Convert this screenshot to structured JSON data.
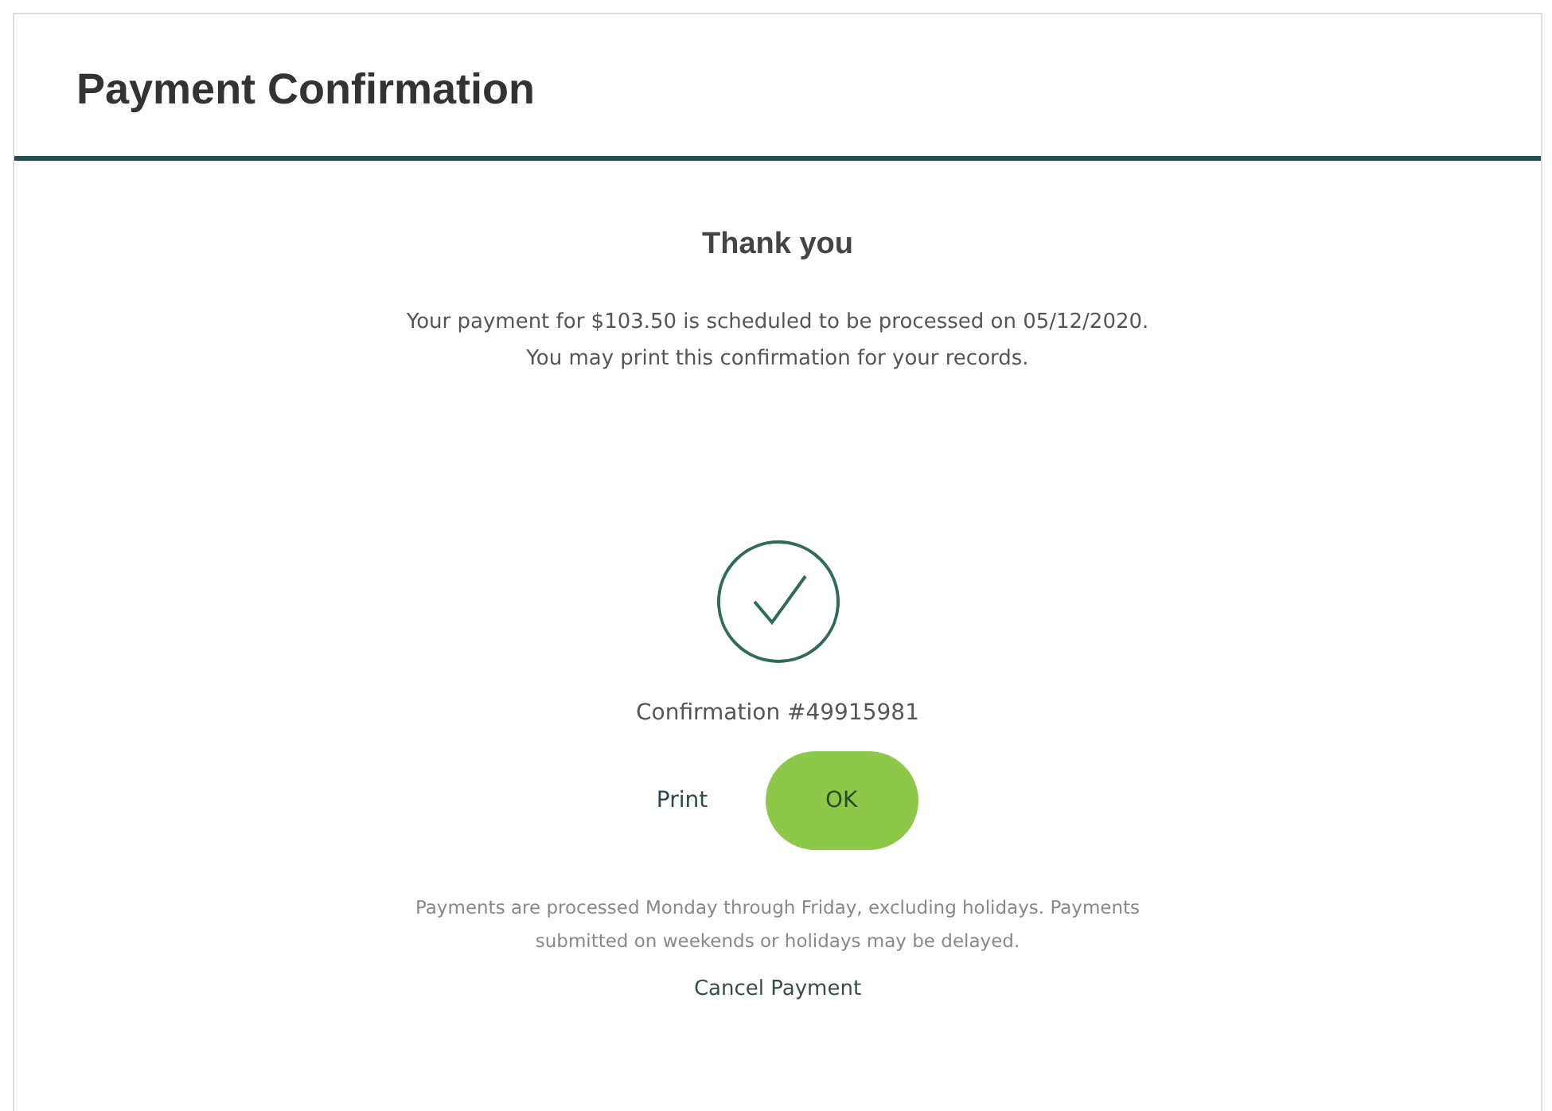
{
  "dialog": {
    "title": "Payment Confirmation"
  },
  "heading": "Thank you",
  "message_lines": [
    "Your payment for $103.50 is scheduled to be processed on 05/12/2020.",
    "You may print this confirmation for your records."
  ],
  "confirmation": "Confirmation #49915981",
  "buttons": [
    {
      "label": "Print",
      "kind": "link"
    },
    {
      "label": "OK",
      "kind": "primary"
    }
  ],
  "note_lines": [
    "Payments are processed Monday through Friday, excluding holidays. Payments",
    "submitted on weekends or holidays may be delayed."
  ],
  "cancel_link": "Cancel Payment"
}
